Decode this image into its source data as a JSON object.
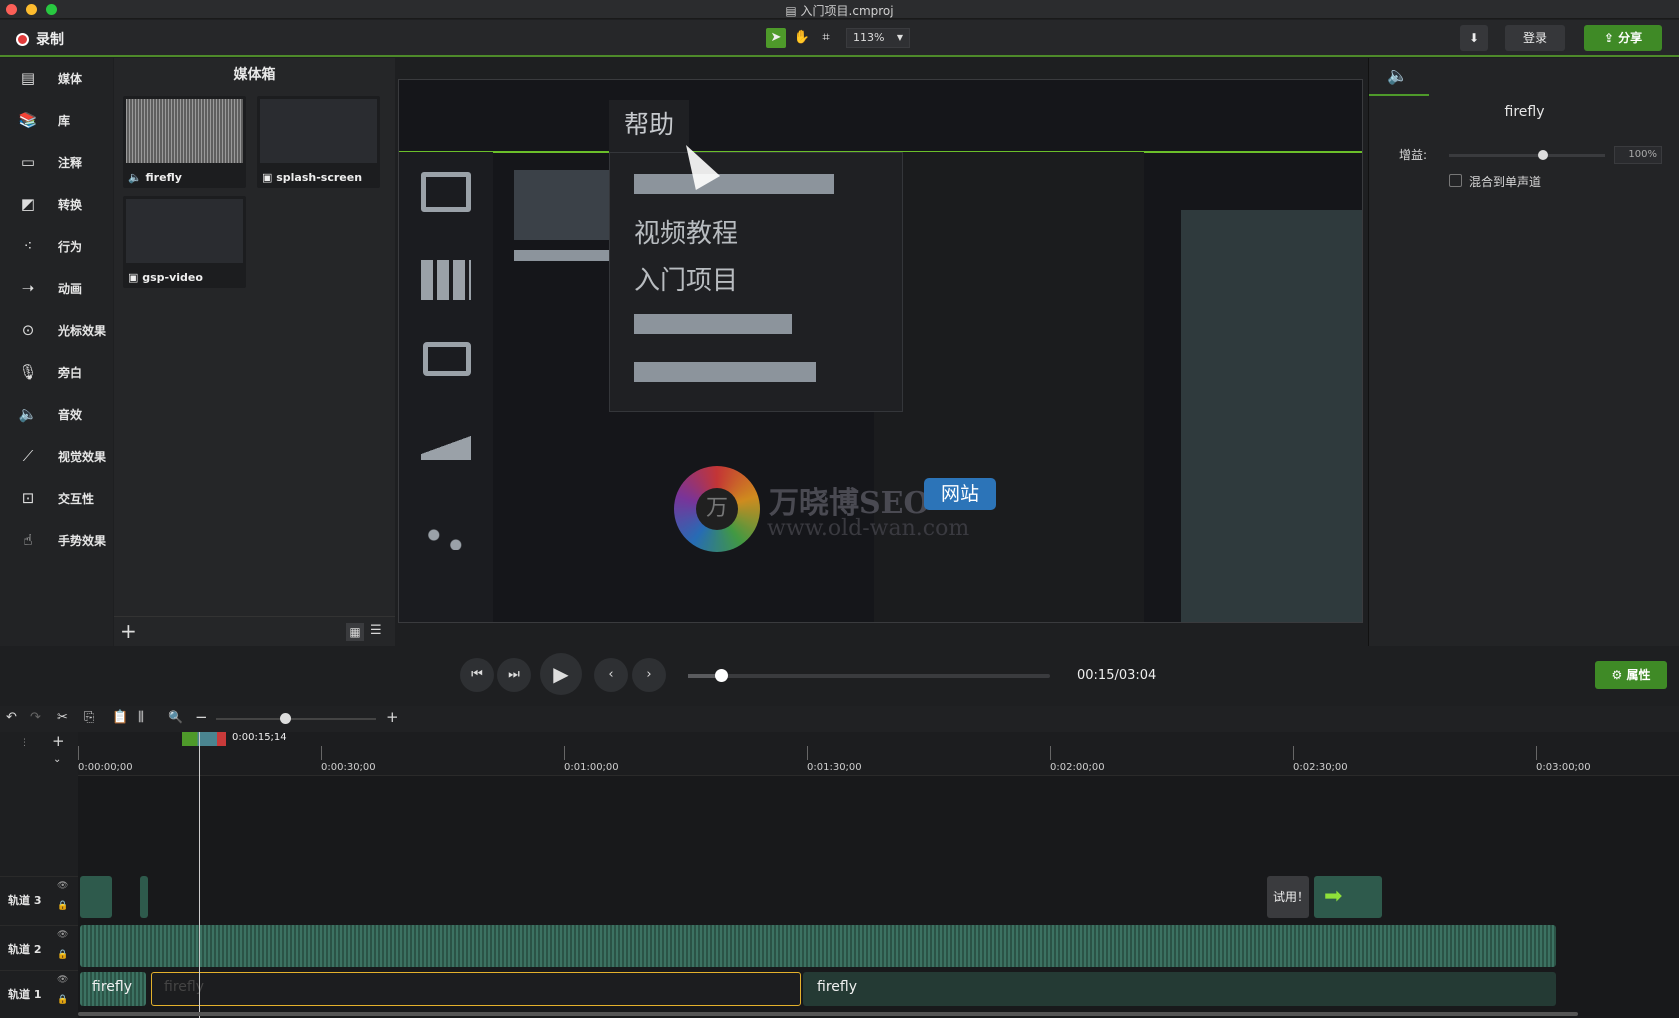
{
  "window": {
    "title": "入门项目.cmproj"
  },
  "toolbar": {
    "record_label": "录制",
    "zoom": "113%",
    "login_label": "登录",
    "share_label": "分享"
  },
  "nav": {
    "items": [
      {
        "label": "媒体",
        "icon": "media-icon"
      },
      {
        "label": "库",
        "icon": "library-icon"
      },
      {
        "label": "注释",
        "icon": "annotation-icon"
      },
      {
        "label": "转换",
        "icon": "transition-icon"
      },
      {
        "label": "行为",
        "icon": "behavior-icon"
      },
      {
        "label": "动画",
        "icon": "animation-icon"
      },
      {
        "label": "光标效果",
        "icon": "cursor-effect-icon"
      },
      {
        "label": "旁白",
        "icon": "microphone-icon"
      },
      {
        "label": "音效",
        "icon": "speaker-icon"
      },
      {
        "label": "视觉效果",
        "icon": "wand-icon"
      },
      {
        "label": "交互性",
        "icon": "interactive-icon"
      },
      {
        "label": "手势效果",
        "icon": "hand-gesture-icon"
      }
    ]
  },
  "bin": {
    "title": "媒体箱",
    "items": [
      {
        "name": "firefly",
        "type": "audio"
      },
      {
        "name": "splash-screen",
        "type": "video"
      },
      {
        "name": "gsp-video",
        "type": "video"
      }
    ]
  },
  "canvas": {
    "menu_title": "帮助",
    "menu_items": [
      "视频教程",
      "入门项目"
    ],
    "watermark_brand": "万晓博SEO",
    "watermark_badge": "网站",
    "watermark_url": "www.old-wan.com",
    "logo_char": "万"
  },
  "properties": {
    "clip_name": "firefly",
    "gain_label": "增益:",
    "gain_value": "100%",
    "gain_level": 0.6,
    "mono_label": "混合到单声道"
  },
  "playback": {
    "time": "00:15/03:04",
    "progress": 0.09,
    "props_label": "属性"
  },
  "timeline": {
    "playhead": "0:00:15;14",
    "ruler_ticks": [
      "0:00:00;00",
      "0:00:30;00",
      "0:01:00;00",
      "0:01:30;00",
      "0:02:00;00",
      "0:02:30;00",
      "0:03:00;00"
    ],
    "tracks": [
      {
        "name": "轨道 3"
      },
      {
        "name": "轨道 2"
      },
      {
        "name": "轨道 1"
      }
    ],
    "clip_labels": {
      "track1_a": "firefly",
      "track1_b": "firefly",
      "track1_c": "firefly",
      "try_label": "试用！"
    }
  },
  "colors": {
    "accent_green": "#4e9a2a",
    "record_red": "#e23b3b"
  }
}
